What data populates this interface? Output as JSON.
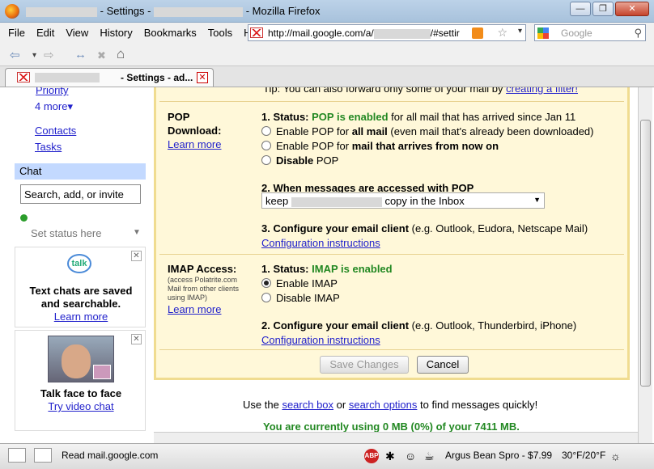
{
  "window": {
    "title_prefix": "- Settings -",
    "title_suffix": "- Mozilla Firefox",
    "min": "—",
    "restore": "❐",
    "close": "✕"
  },
  "menu": [
    "File",
    "Edit",
    "View",
    "History",
    "Bookmarks",
    "Tools",
    "Help"
  ],
  "url": {
    "prefix": "http://mail.google.com/a/",
    "suffix": "/#settir",
    "star": "☆",
    "drop": "▾"
  },
  "search": {
    "placeholder": "Google",
    "icon": "⚲"
  },
  "nav": {
    "back": "⇦",
    "fwd": "⇨",
    "reload": "↔",
    "stop": "✖",
    "home": "⌂"
  },
  "tab": {
    "title": "- Settings - ad...",
    "close": "✕"
  },
  "sidebar": {
    "priority": "Priority",
    "more": "4 more▾",
    "contacts": "Contacts",
    "tasks": "Tasks",
    "chat": "Chat",
    "chat_input": "Search, add, or invite",
    "status": "Set status here",
    "status_arrow": "▼",
    "promo1": {
      "talk": "talk",
      "text1": "Text chats are saved",
      "text2": "and searchable.",
      "link": "Learn more",
      "close": "✕"
    },
    "promo2": {
      "text": "Talk face to face",
      "link": "Try video chat",
      "close": "✕"
    }
  },
  "tip": {
    "text": "Tip: You can also forward only some of your mail by",
    "link": "creating a filter!"
  },
  "pop": {
    "label1": "POP",
    "label2": "Download:",
    "learn": "Learn more",
    "s1_num": "1. Status:",
    "s1_status": "POP is enabled",
    "s1_rest": " for all mail that has arrived since Jan 11",
    "opt1_a": "Enable POP for ",
    "opt1_b": "all mail",
    "opt1_c": " (even mail that's already been downloaded)",
    "opt2_a": "Enable POP for ",
    "opt2_b": "mail that arrives from now on",
    "opt3_a": "Disable",
    "opt3_b": " POP",
    "s2": "2. When messages are accessed with POP",
    "select_a": "keep",
    "select_b": "copy in the Inbox",
    "select_arrow": "▼",
    "s3_a": "3. Configure your email client",
    "s3_b": " (e.g. Outlook, Eudora, Netscape Mail)",
    "config": "Configuration instructions"
  },
  "imap": {
    "label": "IMAP Access:",
    "sub1": "(access Polatrite.com",
    "sub2": "Mail from other clients",
    "sub3": "using IMAP)",
    "learn": "Learn more",
    "s1_num": "1. Status:",
    "s1_status": "IMAP is enabled",
    "opt1": "Enable IMAP",
    "opt2": "Disable IMAP",
    "s2_a": "2. Configure your email client",
    "s2_b": " (e.g. Outlook, Thunderbird, iPhone)",
    "config": "Configuration instructions"
  },
  "buttons": {
    "save": "Save Changes",
    "cancel": "Cancel"
  },
  "bottom": {
    "a": "Use the",
    "link1": "search box",
    "b": "or",
    "link2": "search options",
    "c": "to find messages quickly!",
    "usage": "You are currently using 0 MB (0%) of your 7411 MB."
  },
  "status": {
    "text": "Read mail.google.com",
    "abp": "ABP",
    "bean": "Argus Bean Spro - $7.99",
    "temp": "30°F/20°F"
  }
}
